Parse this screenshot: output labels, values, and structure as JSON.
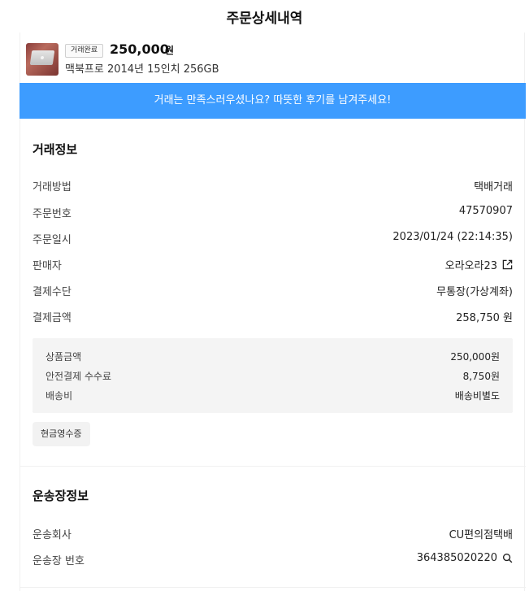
{
  "header": {
    "title": "주문상세내역"
  },
  "product": {
    "status": "거래완료",
    "price": "250,000",
    "price_unit": "원",
    "name": "맥북프로 2014년 15인치 256GB"
  },
  "banner": {
    "text": "거래는 만족스러우셨나요? 따뜻한 후기를 남겨주세요!"
  },
  "trade_info": {
    "title": "거래정보",
    "rows": [
      {
        "label": "거래방법",
        "value": "택배거래"
      },
      {
        "label": "주문번호",
        "value": "47570907"
      },
      {
        "label": "주문일시",
        "value": "2023/01/24 (22:14:35)"
      },
      {
        "label": "판매자",
        "value": "오라오라23"
      },
      {
        "label": "결제수단",
        "value": "무통장(가상계좌)"
      },
      {
        "label": "결제금액",
        "value": "258,750 원"
      }
    ],
    "breakdown": [
      {
        "label": "상품금액",
        "value": "250,000원"
      },
      {
        "label": "안전결제 수수료",
        "value": "8,750원"
      },
      {
        "label": "배송비",
        "value": "배송비별도"
      }
    ],
    "receipt_button": "현금영수증"
  },
  "shipping_info": {
    "title": "운송장정보",
    "rows": [
      {
        "label": "운송회사",
        "value": "CU편의점택배"
      },
      {
        "label": "운송장 번호",
        "value": "364385020220"
      }
    ]
  },
  "icons": {
    "seller_link": "external-link-icon",
    "tracking_search": "search-icon"
  },
  "colors": {
    "banner": "#3d9cff",
    "breakdown_bg": "#f4f4f4"
  }
}
